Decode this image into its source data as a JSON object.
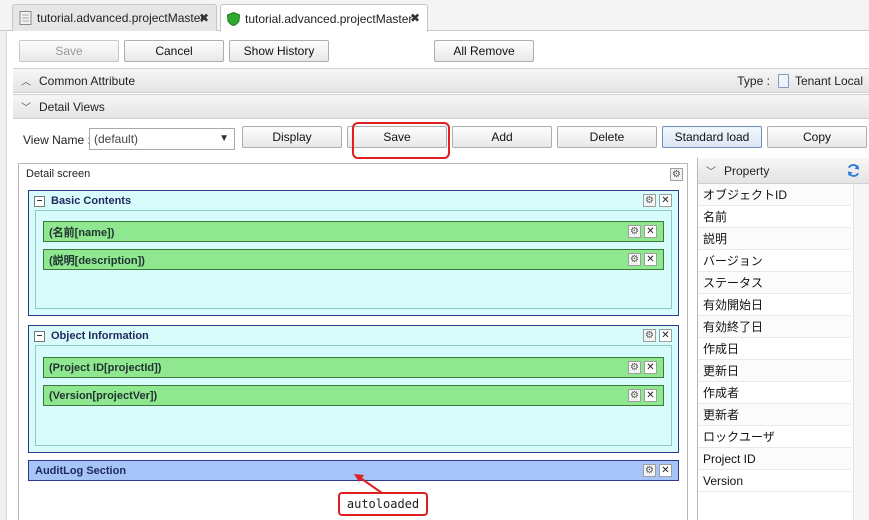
{
  "tabs": [
    {
      "label": "tutorial.advanced.projectMaster",
      "icon": "document-icon",
      "active": false
    },
    {
      "label": "tutorial.advanced.projectMaster",
      "icon": "green-shield-icon",
      "active": true
    }
  ],
  "toolbar": {
    "save": "Save",
    "cancel": "Cancel",
    "show_history": "Show History",
    "all_remove": "All Remove"
  },
  "common_attribute": {
    "label": "Common Attribute",
    "type_label": "Type :",
    "type_value": "Tenant Local"
  },
  "detail_views": {
    "label": "Detail Views"
  },
  "view_row": {
    "label": "View Name :",
    "selected": "(default)",
    "buttons": {
      "display": "Display",
      "save": "Save",
      "add": "Add",
      "delete": "Delete",
      "standard_load": "Standard load",
      "copy": "Copy"
    }
  },
  "detail_screen": {
    "title": "Detail screen",
    "sections": [
      {
        "title": "Basic Contents",
        "fields": [
          "(名前[name])",
          "(説明[description])"
        ]
      },
      {
        "title": "Object Information",
        "fields": [
          "(Project ID[projectId])",
          "(Version[projectVer])"
        ]
      }
    ],
    "audit_section": "AuditLog Section",
    "annotation": "autoloaded"
  },
  "property": {
    "title": "Property",
    "items": [
      "オブジェクトID",
      "名前",
      "説明",
      "バージョン",
      "ステータス",
      "有効開始日",
      "有効終了日",
      "作成日",
      "更新日",
      "作成者",
      "更新者",
      "ロックユーザ",
      "Project ID",
      "Version"
    ]
  },
  "colors": {
    "accent_red": "#e02020",
    "section_bg": "#d8fbfb",
    "field_bg": "#8fe88f",
    "audit_bg": "#a6c4f8"
  }
}
